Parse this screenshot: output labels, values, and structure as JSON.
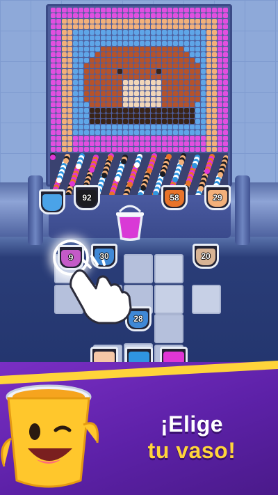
{
  "headline": {
    "line1": "¡Elige",
    "line2": "tu vaso!"
  },
  "cups_top": [
    {
      "id": "cup-left-edge",
      "count": "",
      "color": "#4aa3e8"
    },
    {
      "id": "cup-black",
      "count": "92",
      "color": "#1c1c22"
    },
    {
      "id": "cup-orange",
      "count": "58",
      "color": "#e8732a"
    },
    {
      "id": "cup-peach",
      "count": "29",
      "color": "#f3b07a"
    }
  ],
  "cups_board": [
    {
      "id": "cup-pink-selected",
      "count": "9",
      "color": "#c45ac8"
    },
    {
      "id": "cup-blue-30",
      "count": "30",
      "color": "#3f88d6"
    },
    {
      "id": "cup-beige-20",
      "count": "20",
      "color": "#d7b394"
    },
    {
      "id": "cup-blue-28",
      "count": "28",
      "color": "#3f88d6"
    }
  ],
  "cups_bottom": [
    {
      "id": "cup-peach-bottom",
      "color": "#f5c7a6"
    },
    {
      "id": "cup-blue-bottom",
      "color": "#2f95e0"
    },
    {
      "id": "cup-magenta-bottom",
      "color": "#e036d4"
    }
  ],
  "colors": {
    "magenta": "#e24fe0",
    "sky": "#5fa6e8",
    "brown": "#b5532b",
    "dark": "#3a2418",
    "cream": "#f2d6b8",
    "peach": "#f3b07a",
    "banner_purple": "#6a27b8",
    "accent_yellow": "#ffd43a"
  },
  "icons": {
    "hand": "pointing-hand-icon",
    "bucket": "pink-bucket-icon",
    "mascot": "yellow-cup-mascot-icon"
  }
}
